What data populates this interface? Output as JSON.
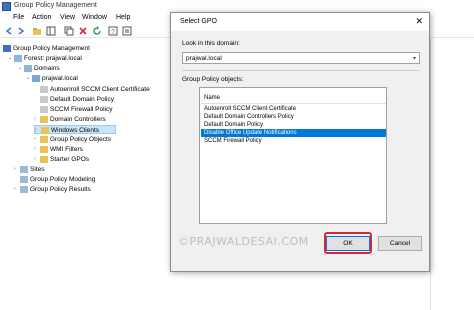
{
  "window": {
    "title": "Group Policy Management"
  },
  "menu": [
    "File",
    "Action",
    "View",
    "Window",
    "Help"
  ],
  "tree": {
    "root": "Group Policy Management",
    "forest": "Forest: prajwal.local",
    "domains": "Domains",
    "domain": "prajwal.local",
    "items": [
      "Autoenroll SCCM Client Certificate",
      "Default Domain Policy",
      "SCCM Firewall Policy",
      "Domain Controllers",
      "Windows Clients",
      "Group Policy Objects",
      "WMI Filters",
      "Starter GPOs"
    ],
    "sites": "Sites",
    "modeling": "Group Policy Modeling",
    "results": "Group Policy Results"
  },
  "dialog": {
    "title": "Select GPO",
    "close": "✕",
    "look_in_label": "Look in this domain:",
    "domain_value": "prajwal.local",
    "gpo_label": "Group Policy objects:",
    "column_name": "Name",
    "gpos": [
      "Autoenroll SCCM Client Certificate",
      "Default Domain Controllers Policy",
      "Default Domain Policy",
      "Disable Office Update Notifications",
      "SCCM Firewall Policy"
    ],
    "selected_index": 3,
    "ok": "OK",
    "cancel": "Cancel"
  },
  "watermark": "©PRAJWALDESAI.COM",
  "colors": {
    "selection": "#0078d7",
    "highlight_box": "#d9263c"
  }
}
